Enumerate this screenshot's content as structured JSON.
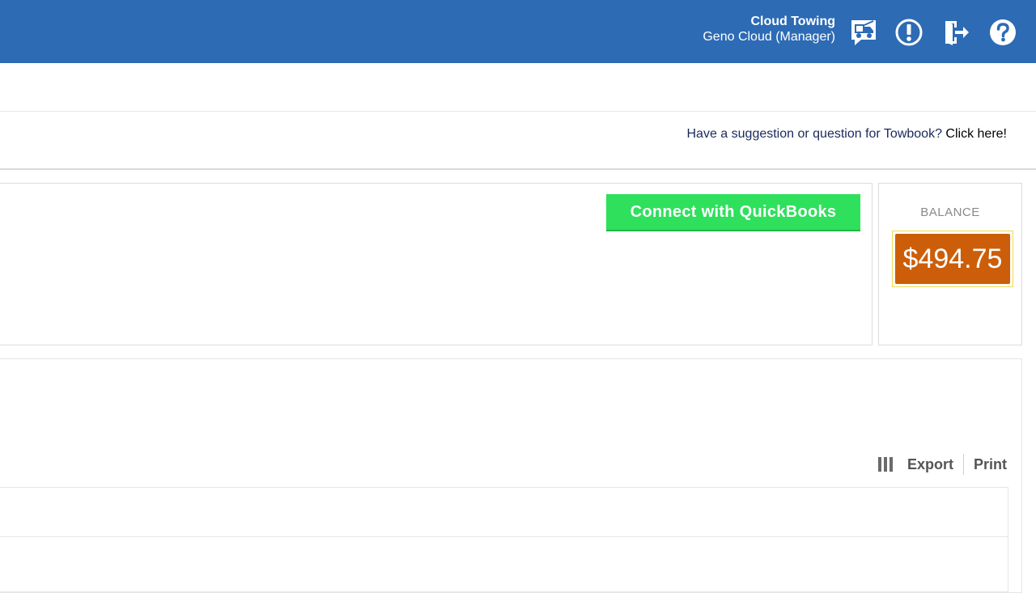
{
  "header": {
    "company": "Cloud Towing",
    "user": "Geno Cloud (Manager)",
    "icons": [
      "truck-chat-icon",
      "alert-icon",
      "logout-icon",
      "help-icon"
    ]
  },
  "suggestion": {
    "text": "Have a suggestion or question for Towbook?",
    "link": "Click here!"
  },
  "quickbooks": {
    "label": "Connect with QuickBooks"
  },
  "balance": {
    "label": "BALANCE",
    "value": "$494.75"
  },
  "toolbar": {
    "export": "Export",
    "print": "Print"
  },
  "colors": {
    "header": "#2d6bb4",
    "quickbooks": "#2ee05c",
    "balance": "#cc5e0a"
  }
}
